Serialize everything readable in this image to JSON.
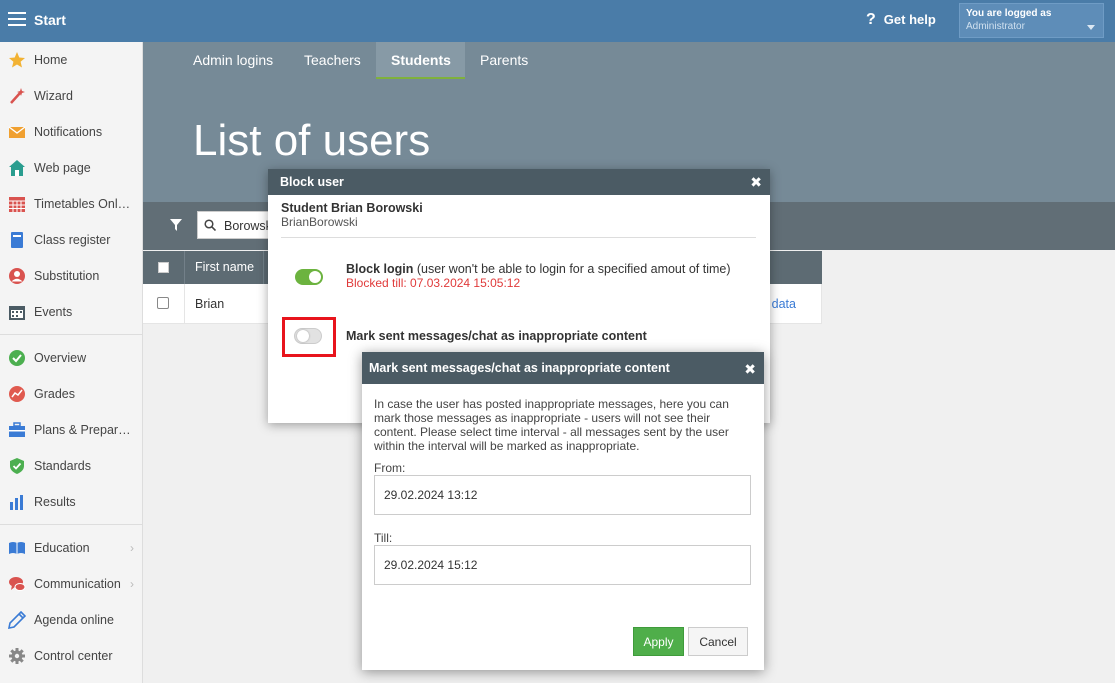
{
  "topbar": {
    "title": "Start",
    "help_label": "Get help",
    "help_icon": "?",
    "login_line1": "You are logged as",
    "login_line2": "Administrator"
  },
  "sidebar": {
    "items": [
      {
        "label": "Home",
        "icon": "star-icon",
        "color": "#f2b233"
      },
      {
        "label": "Wizard",
        "icon": "wand-icon",
        "color": "#d9534f"
      },
      {
        "label": "Notifications",
        "icon": "envelope-icon",
        "color": "#f0a030"
      },
      {
        "label": "Web page",
        "icon": "house-icon",
        "color": "#2a9d8f"
      },
      {
        "label": "Timetables Onl…",
        "icon": "calendar-grid-icon",
        "color": "#d9534f"
      },
      {
        "label": "Class register",
        "icon": "book-icon",
        "color": "#3a7bd5"
      },
      {
        "label": "Substitution",
        "icon": "person-icon",
        "color": "#d9534f"
      },
      {
        "label": "Events",
        "icon": "calendar-icon",
        "color": "#4b5b64"
      },
      {
        "label": "Overview",
        "icon": "check-circle-icon",
        "color": "#4caf50"
      },
      {
        "label": "Grades",
        "icon": "chart-circle-icon",
        "color": "#e05a4f"
      },
      {
        "label": "Plans & Prepar…",
        "icon": "briefcase-icon",
        "color": "#3a7bd5"
      },
      {
        "label": "Standards",
        "icon": "shield-check-icon",
        "color": "#4caf50"
      },
      {
        "label": "Results",
        "icon": "bar-chart-icon",
        "color": "#3a7bd5"
      },
      {
        "label": "Education",
        "icon": "open-book-icon",
        "color": "#3a7bd5"
      },
      {
        "label": "Communication",
        "icon": "chat-icon",
        "color": "#d9534f"
      },
      {
        "label": "Agenda online",
        "icon": "pen-icon",
        "color": "#3a7bd5"
      },
      {
        "label": "Control center",
        "icon": "gear-icon",
        "color": "#888888"
      }
    ]
  },
  "tabs": [
    {
      "label": "Admin logins"
    },
    {
      "label": "Teachers"
    },
    {
      "label": "Students"
    },
    {
      "label": "Parents"
    }
  ],
  "page_title": "List of users",
  "search": {
    "value": "Borowsk"
  },
  "table": {
    "header_first": "First name",
    "row_first": "Brian",
    "row_link": "r data"
  },
  "block_dialog": {
    "title": "Block user",
    "student_name": "Student Brian Borowski",
    "username": "BrianBorowski",
    "block_login_bold": "Block login",
    "block_login_rest": " (user won't be able to login for a specified amout of time)",
    "blocked_till": "Blocked till: 07.03.2024 15:05:12",
    "mark_label": "Mark sent messages/chat as inappropriate content",
    "block_login_on": true,
    "mark_on": false
  },
  "mark_dialog": {
    "title": "Mark sent messages/chat as inappropriate content",
    "description": "In case the user has posted inappropriate messages, here you can mark those messages as inappropriate - users will not see their content. Please select time interval - all messages sent by the user within the interval will be marked as inappropriate.",
    "from_label": "From:",
    "from_value": "29.02.2024 13:12",
    "till_label": "Till:",
    "till_value": "29.02.2024 15:12",
    "apply_label": "Apply",
    "cancel_label": "Cancel"
  }
}
